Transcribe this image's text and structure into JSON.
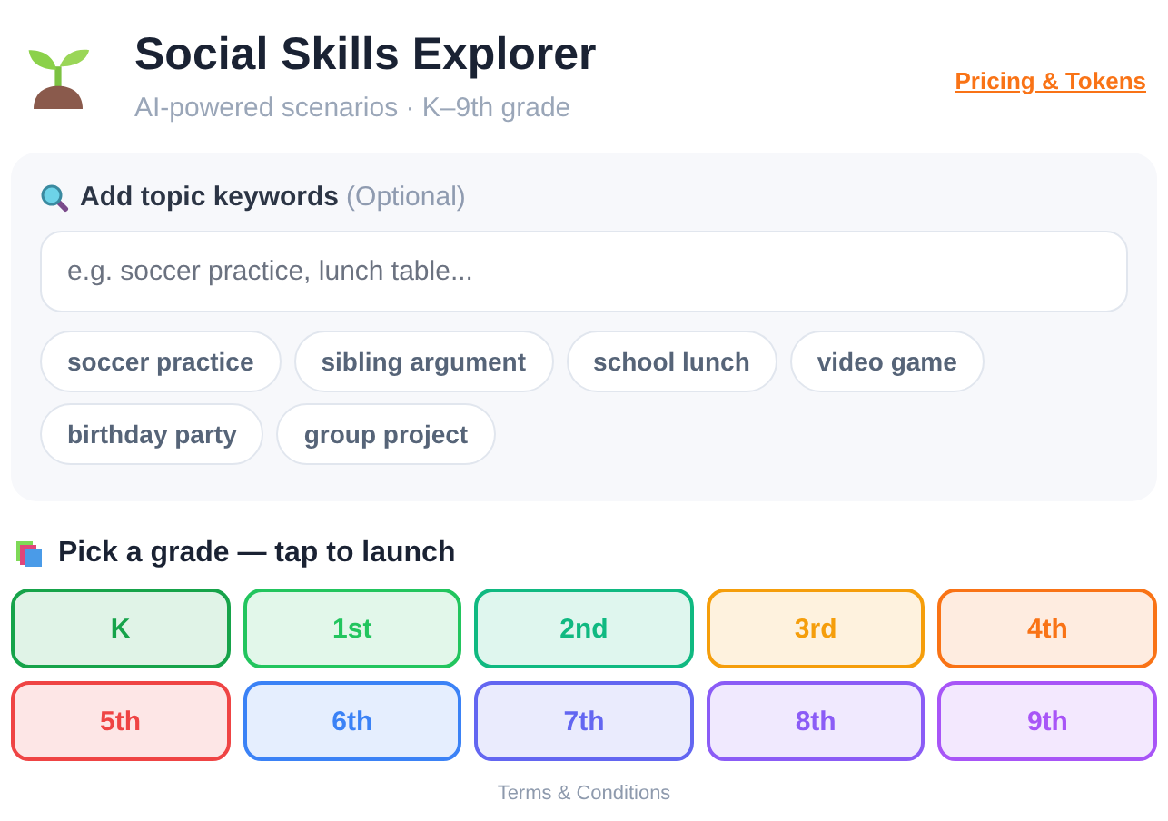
{
  "header": {
    "title": "Social Skills Explorer",
    "subtitle": "AI-powered scenarios · K–9th grade",
    "link": "Pricing & Tokens"
  },
  "keywords": {
    "label": "Add topic keywords",
    "hint": "(Optional)",
    "placeholder": "e.g. soccer practice, lunch table...",
    "chips": [
      "soccer practice",
      "sibling argument",
      "school lunch",
      "video game",
      "birthday party",
      "group project"
    ]
  },
  "grades": {
    "label": "Pick a grade — tap to launch",
    "items": [
      {
        "label": "K",
        "color": "#16a34a"
      },
      {
        "label": "1st",
        "color": "#22c55e"
      },
      {
        "label": "2nd",
        "color": "#10b981"
      },
      {
        "label": "3rd",
        "color": "#f59e0b"
      },
      {
        "label": "4th",
        "color": "#f97316"
      },
      {
        "label": "5th",
        "color": "#ef4444"
      },
      {
        "label": "6th",
        "color": "#3b82f6"
      },
      {
        "label": "7th",
        "color": "#6366f1"
      },
      {
        "label": "8th",
        "color": "#8b5cf6"
      },
      {
        "label": "9th",
        "color": "#a855f7"
      }
    ]
  },
  "footer": {
    "link": "Terms & Conditions"
  }
}
